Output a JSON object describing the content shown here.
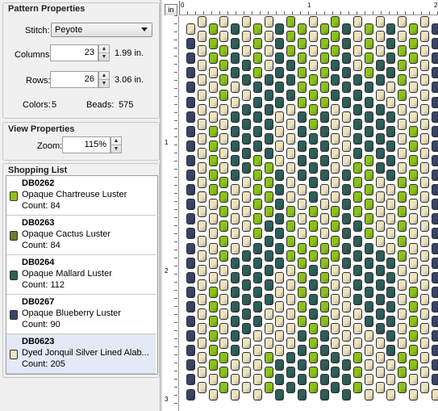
{
  "pattern": {
    "title": "Pattern Properties",
    "stitch_label": "Stitch:",
    "stitch_value": "Peyote",
    "columns_label": "Columns:",
    "columns_value": "23",
    "columns_inches": "1.99 in.",
    "rows_label": "Rows:",
    "rows_value": "26",
    "rows_inches": "3.06 in.",
    "colors_label": "Colors:",
    "colors_value": "5",
    "beads_label": "Beads:",
    "beads_value": "575"
  },
  "view": {
    "title": "View Properties",
    "zoom_label": "Zoom:",
    "zoom_value": "115%"
  },
  "shopping": {
    "title": "Shopping List",
    "items": [
      {
        "code": "DB0262",
        "name": "Opaque Chartreuse Luster",
        "count": "Count: 84",
        "color": "#8cc21c"
      },
      {
        "code": "DB0263",
        "name": "Opaque Cactus Luster",
        "count": "Count: 84",
        "color": "#6f7b2c"
      },
      {
        "code": "DB0264",
        "name": "Opaque Mallard Luster",
        "count": "Count: 112",
        "color": "#2f5f5a"
      },
      {
        "code": "DB0267",
        "name": "Opaque Blueberry Luster",
        "count": "Count: 90",
        "color": "#3a4468"
      },
      {
        "code": "DB0623",
        "name": "Dyed Jonquil Silver Lined Alab...",
        "count": "Count: 205",
        "color": "#ece3c0"
      }
    ]
  },
  "ruler": {
    "unit_button": "in",
    "h_labels": [
      "0",
      "1",
      "2"
    ],
    "v_labels": [
      "1",
      "2",
      "3"
    ]
  },
  "pattern_columns": [
    "JBBBBBBBBBBBBBBBBBBBBBBBBB",
    "JJJJJJJJJJJJJJJJJJJJJJJJJJ",
    "CCCJJJJCCCCCJJJJJJCCCCCCJJ",
    "JJCCCCJJJJJCCCCCCJJJJJJCCC",
    "MMMMJJMMMMMJJJJJMMMMMMMJJJ",
    "JJJMMJMMMMMJJJJJMMMMMMJJJJ",
    "CCCCMMMMMCCCCCCMMMMMMJJJJJ",
    "JJJJMMMMMMCCCCMMMMMMJJJCCC",
    "MMMMMMJJJJMMMMMMMJJJJJJMMM",
    "CCCMMMJJJJJJJCCCCJJJJJJMMM",
    "CCCCCCMMMMMJJJJCCCCCCMMMMM",
    "JJJJCCCCMMMMMCCCCMMMMCCCCC",
    "CCCCCCMMMMMJJJJCCCCCCMMMMM",
    "CCCMMMJJJJJJJCCCCJJJJJJMMM",
    "MMMMMMJJJJMMMMMMMJJJJJJMMM",
    "JJJJMMMMMMCCCCMMMMMMJJJCCC",
    "CCCCMMMMMCCCCCCMMMMMMJJJJJ",
    "JJJMMJMMMMMJJJJJMMMMMMJJJJ",
    "MMMMJJMMMMMJJJJJMMMMMMMJJJ",
    "JJCCCCJJJJJCCCCCCJJJJJJCCC",
    "CCCJJJJCCCCCJJJJJJCCCCCCJJ",
    "JJJJJJJJJJJJJJJJJJJJJJJJJJ",
    "BBBBBBBBBBBBBBBBBBBBBBBBBJ"
  ],
  "palette": {
    "C": "#8cc21c",
    "K": "#6f7b2c",
    "M": "#2f5f5a",
    "B": "#3a4468",
    "J": "#ece3c0",
    "O": "#6f7b2c"
  }
}
